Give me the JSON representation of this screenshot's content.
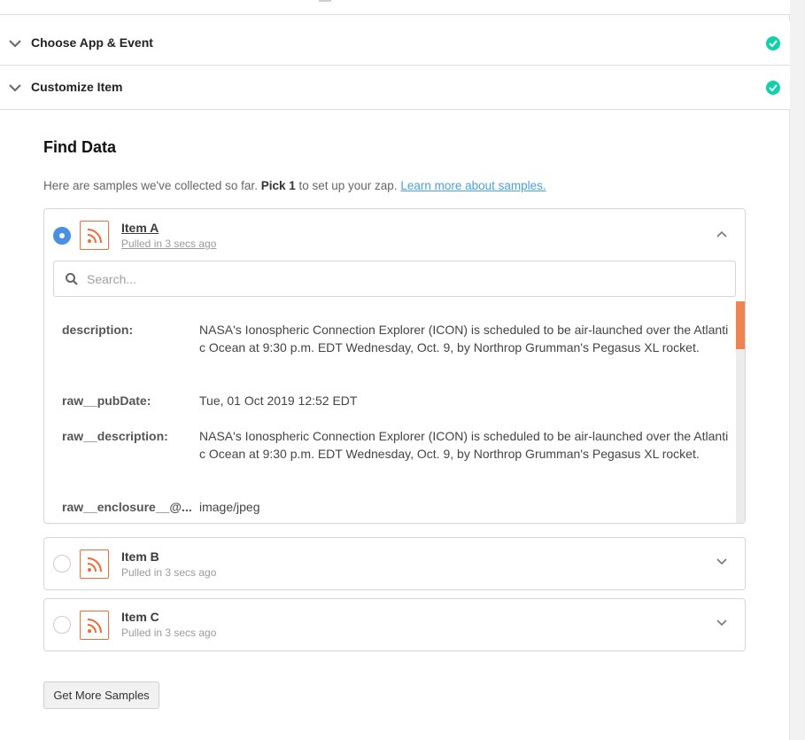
{
  "sections": [
    {
      "title": "Choose App & Event"
    },
    {
      "title": "Customize Item"
    }
  ],
  "find_data": {
    "title": "Find Data",
    "intro_text": "Here are samples we've collected so far. ",
    "intro_bold": "Pick 1",
    "intro_after": " to set up your zap. ",
    "intro_link": "Learn more about samples."
  },
  "items": [
    {
      "name": "Item A",
      "pulled": "Pulled in 3 secs ago",
      "selected": true,
      "expanded": true
    },
    {
      "name": "Item B",
      "pulled": "Pulled in 3 secs ago",
      "selected": false,
      "expanded": false
    },
    {
      "name": "Item C",
      "pulled": "Pulled in 3 secs ago",
      "selected": false,
      "expanded": false
    }
  ],
  "search": {
    "placeholder": "Search...",
    "value": ""
  },
  "fields": [
    {
      "key": "description:",
      "value": "NASA's Ionospheric Connection Explorer (ICON) is scheduled to be air-launched over the Atlantic Ocean at 9:30 p.m. EDT Wednesday, Oct. 9, by Northrop Grumman's Pegasus XL rocket."
    },
    {
      "key": "raw__pubDate:",
      "value": "Tue, 01 Oct 2019 12:52 EDT"
    },
    {
      "key": "raw__description:",
      "value": "NASA's Ionospheric Connection Explorer (ICON) is scheduled to be air-launched over the Atlantic Ocean at 9:30 p.m. EDT Wednesday, Oct. 9, by Northrop Grumman's Pegasus XL rocket."
    },
    {
      "key": "raw__enclosure__@...",
      "value": "image/jpeg"
    }
  ],
  "get_more_button": "Get More Samples",
  "colors": {
    "accent": "#4a90e2",
    "check": "#13d0ab",
    "rss": "#ef6c34",
    "link": "#4a9fdc"
  },
  "icons": {
    "section_toggle": "chevron-down-icon",
    "done": "check-circle-icon",
    "app": "rss-icon",
    "search": "search-icon"
  }
}
